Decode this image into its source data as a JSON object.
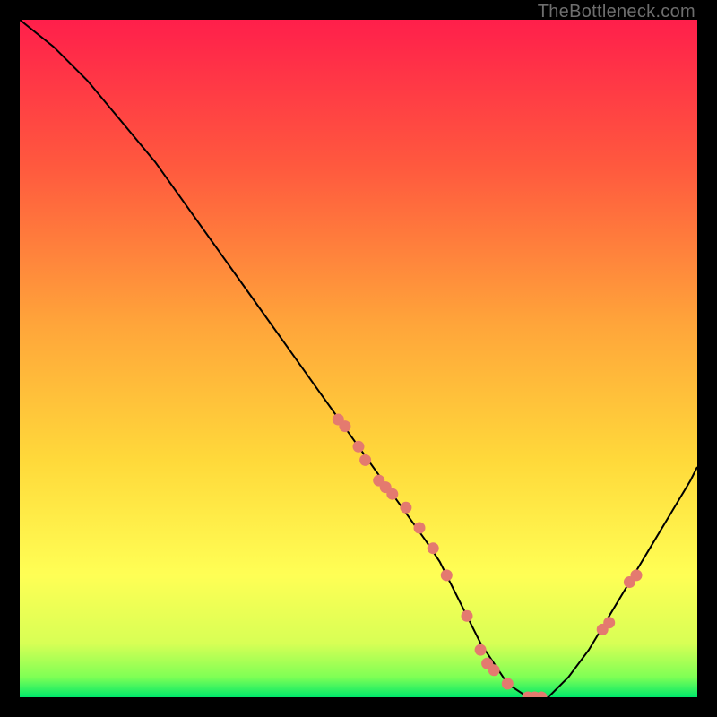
{
  "watermark": "TheBottleneck.com",
  "colors": {
    "gradient_top": "#ff1f4b",
    "gradient_mid1": "#ff6a3a",
    "gradient_mid2": "#ffd23a",
    "gradient_mid3": "#ffff55",
    "gradient_bottom": "#00e86a",
    "curve": "#000000",
    "points": "#e47a6f"
  },
  "chart_data": {
    "type": "line",
    "title": "",
    "xlabel": "",
    "ylabel": "",
    "xlim": [
      0,
      100
    ],
    "ylim": [
      0,
      100
    ],
    "grid": false,
    "legend_position": "none",
    "series": [
      {
        "name": "bottleneck-curve",
        "x": [
          0,
          5,
          10,
          15,
          20,
          25,
          30,
          35,
          40,
          45,
          50,
          55,
          60,
          62,
          64,
          66,
          68,
          70,
          72,
          75,
          78,
          81,
          84,
          87,
          90,
          93,
          96,
          99,
          100
        ],
        "y": [
          100,
          96,
          91,
          85,
          79,
          72,
          65,
          58,
          51,
          44,
          37,
          30,
          23,
          20,
          16,
          12,
          8,
          5,
          2,
          0,
          0,
          3,
          7,
          12,
          17,
          22,
          27,
          32,
          34
        ]
      }
    ],
    "scatter_points": {
      "name": "highlighted-points",
      "x": [
        47,
        48,
        50,
        51,
        53,
        54,
        55,
        57,
        59,
        61,
        63,
        66,
        68,
        69,
        70,
        72,
        75,
        76,
        77,
        86,
        87,
        90,
        91
      ],
      "y": [
        41,
        40,
        37,
        35,
        32,
        31,
        30,
        28,
        25,
        22,
        18,
        12,
        7,
        5,
        4,
        2,
        0,
        0,
        0,
        10,
        11,
        17,
        18
      ]
    }
  }
}
